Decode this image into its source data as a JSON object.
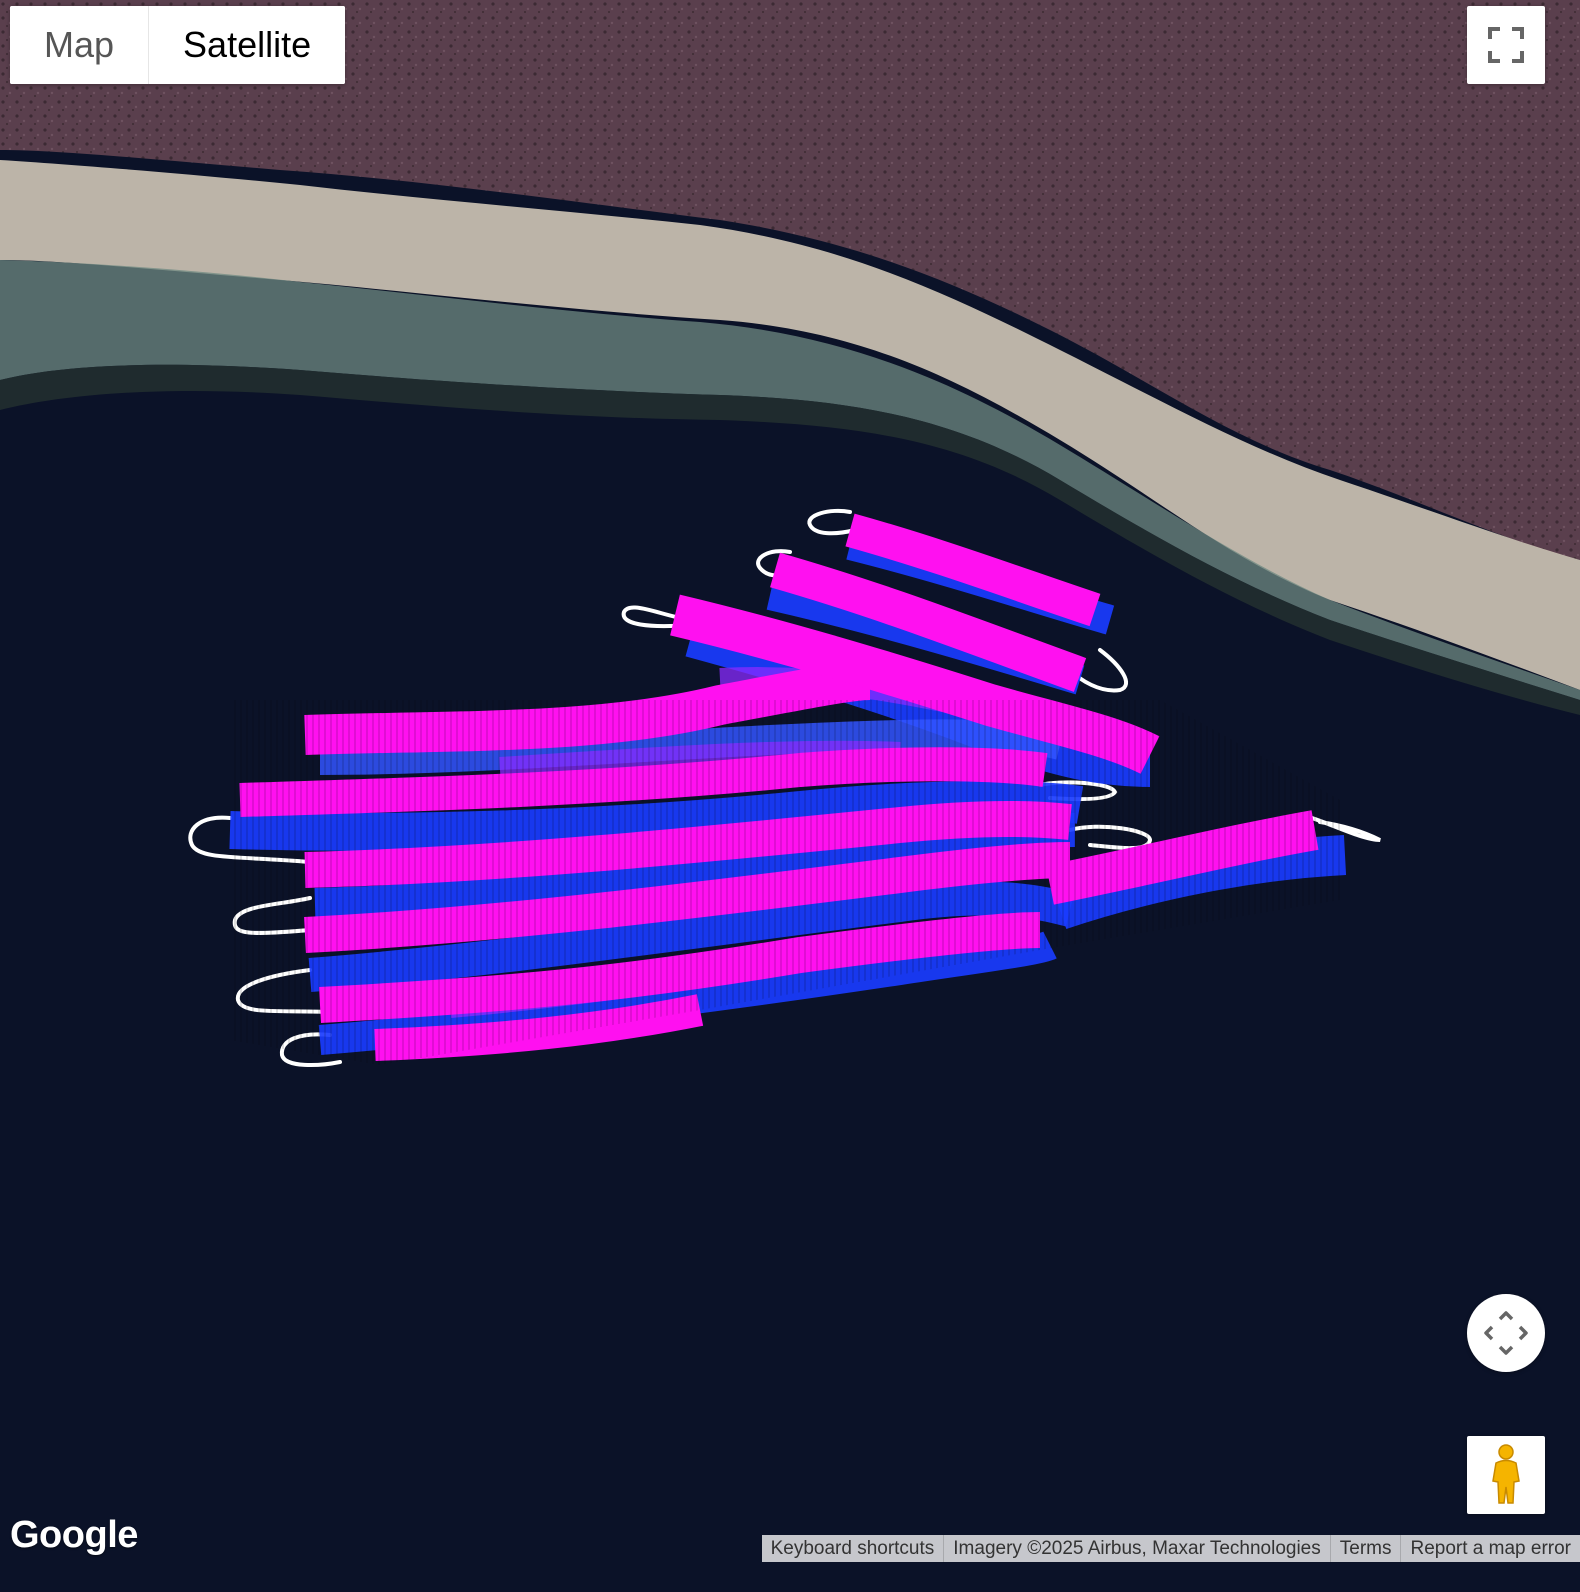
{
  "map_type_control": {
    "map_label": "Map",
    "satellite_label": "Satellite",
    "selected": "Satellite"
  },
  "icons": {
    "fullscreen": "fullscreen-icon",
    "camera": "camera-move-icon",
    "pegman": "pegman-icon"
  },
  "logo": {
    "text": "Google"
  },
  "attribution": {
    "keyboard_shortcuts": "Keyboard shortcuts",
    "imagery": "Imagery ©2025 Airbus, Maxar Technologies",
    "terms": "Terms",
    "report": "Report a map error"
  },
  "colors": {
    "water": "#0b1228",
    "land": "#5a3f4d",
    "shore": "#c9c2b4",
    "track_magenta": "#ff10f0",
    "track_blue": "#1a3cff",
    "track_violet": "#8a2bff",
    "path_outline": "#ffffff"
  }
}
